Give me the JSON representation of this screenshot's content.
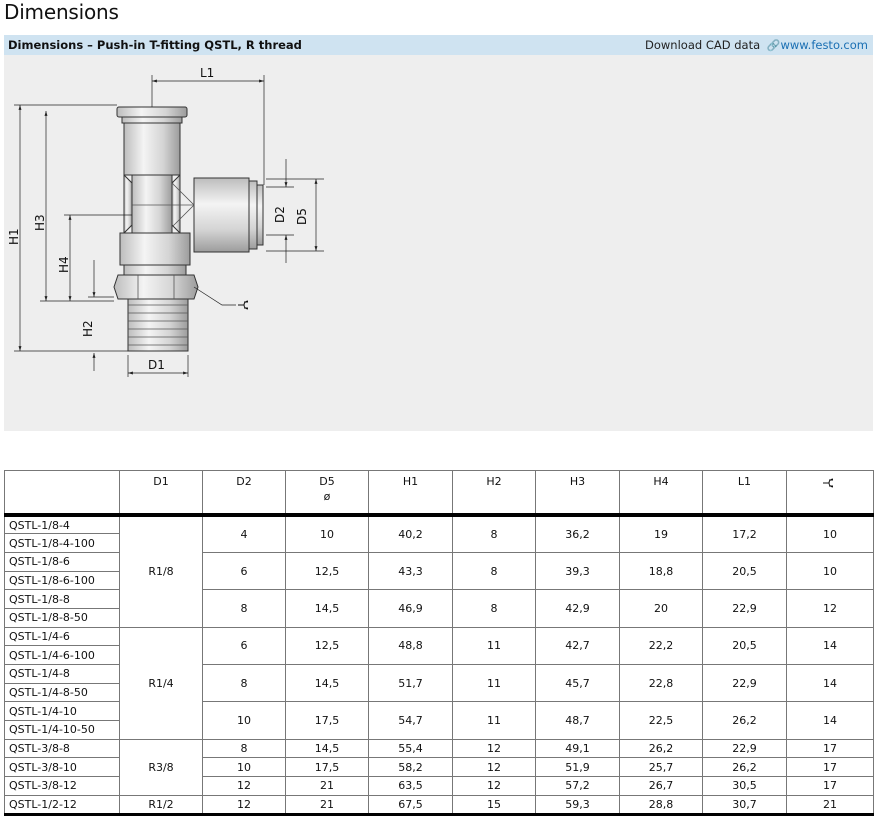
{
  "page": {
    "dimensions_title": "Dimensions"
  },
  "title_bar": {
    "title": "Dimensions – Push-in T-fitting QSTL, R thread",
    "cad_label": "Download CAD data",
    "link_icon": "link-icon",
    "link_text": "www.festo.com",
    "background": "#cfe3f1",
    "link_color": "#1a6fb3"
  },
  "drawing": {
    "labels": {
      "l1": "L1",
      "h1": "H1",
      "h2": "H2",
      "h3": "H3",
      "h4": "H4",
      "d1": "D1",
      "d2": "D2",
      "d5": "D5",
      "wrench": "wrench-icon"
    }
  },
  "table": {
    "headers": {
      "name": "",
      "d1": "D1",
      "d2": "D2",
      "d5": "D5",
      "d5_sub": "ø",
      "h1": "H1",
      "h2": "H2",
      "h3": "H3",
      "h4": "H4",
      "l1": "L1",
      "wrench": "wrench-icon"
    },
    "names": [
      "QSTL-1/8-4",
      "QSTL-1/8-4-100",
      "QSTL-1/8-6",
      "QSTL-1/8-6-100",
      "QSTL-1/8-8",
      "QSTL-1/8-8-50",
      "QSTL-1/4-6",
      "QSTL-1/4-6-100",
      "QSTL-1/4-8",
      "QSTL-1/4-8-50",
      "QSTL-1/4-10",
      "QSTL-1/4-10-50",
      "QSTL-3/8-8",
      "QSTL-3/8-10",
      "QSTL-3/8-12",
      "QSTL-1/2-12"
    ],
    "d1_groups": [
      "R1/8",
      "R1/4",
      "R3/8",
      "R1/2"
    ],
    "groups": [
      {
        "d2": "4",
        "d5": "10",
        "h1": "40,2",
        "h2": "8",
        "h3": "36,2",
        "h4": "19",
        "l1": "17,2",
        "w": "10"
      },
      {
        "d2": "6",
        "d5": "12,5",
        "h1": "43,3",
        "h2": "8",
        "h3": "39,3",
        "h4": "18,8",
        "l1": "20,5",
        "w": "10"
      },
      {
        "d2": "8",
        "d5": "14,5",
        "h1": "46,9",
        "h2": "8",
        "h3": "42,9",
        "h4": "20",
        "l1": "22,9",
        "w": "12"
      },
      {
        "d2": "6",
        "d5": "12,5",
        "h1": "48,8",
        "h2": "11",
        "h3": "42,7",
        "h4": "22,2",
        "l1": "20,5",
        "w": "14"
      },
      {
        "d2": "8",
        "d5": "14,5",
        "h1": "51,7",
        "h2": "11",
        "h3": "45,7",
        "h4": "22,8",
        "l1": "22,9",
        "w": "14"
      },
      {
        "d2": "10",
        "d5": "17,5",
        "h1": "54,7",
        "h2": "11",
        "h3": "48,7",
        "h4": "22,5",
        "l1": "26,2",
        "w": "14"
      },
      {
        "d2": "8",
        "d5": "14,5",
        "h1": "55,4",
        "h2": "12",
        "h3": "49,1",
        "h4": "26,2",
        "l1": "22,9",
        "w": "17"
      },
      {
        "d2": "10",
        "d5": "17,5",
        "h1": "58,2",
        "h2": "12",
        "h3": "51,9",
        "h4": "25,7",
        "l1": "26,2",
        "w": "17"
      },
      {
        "d2": "12",
        "d5": "21",
        "h1": "63,5",
        "h2": "12",
        "h3": "57,2",
        "h4": "26,7",
        "l1": "30,5",
        "w": "17"
      },
      {
        "d2": "12",
        "d5": "21",
        "h1": "67,5",
        "h2": "15",
        "h3": "59,3",
        "h4": "28,8",
        "l1": "30,7",
        "w": "21"
      }
    ]
  }
}
